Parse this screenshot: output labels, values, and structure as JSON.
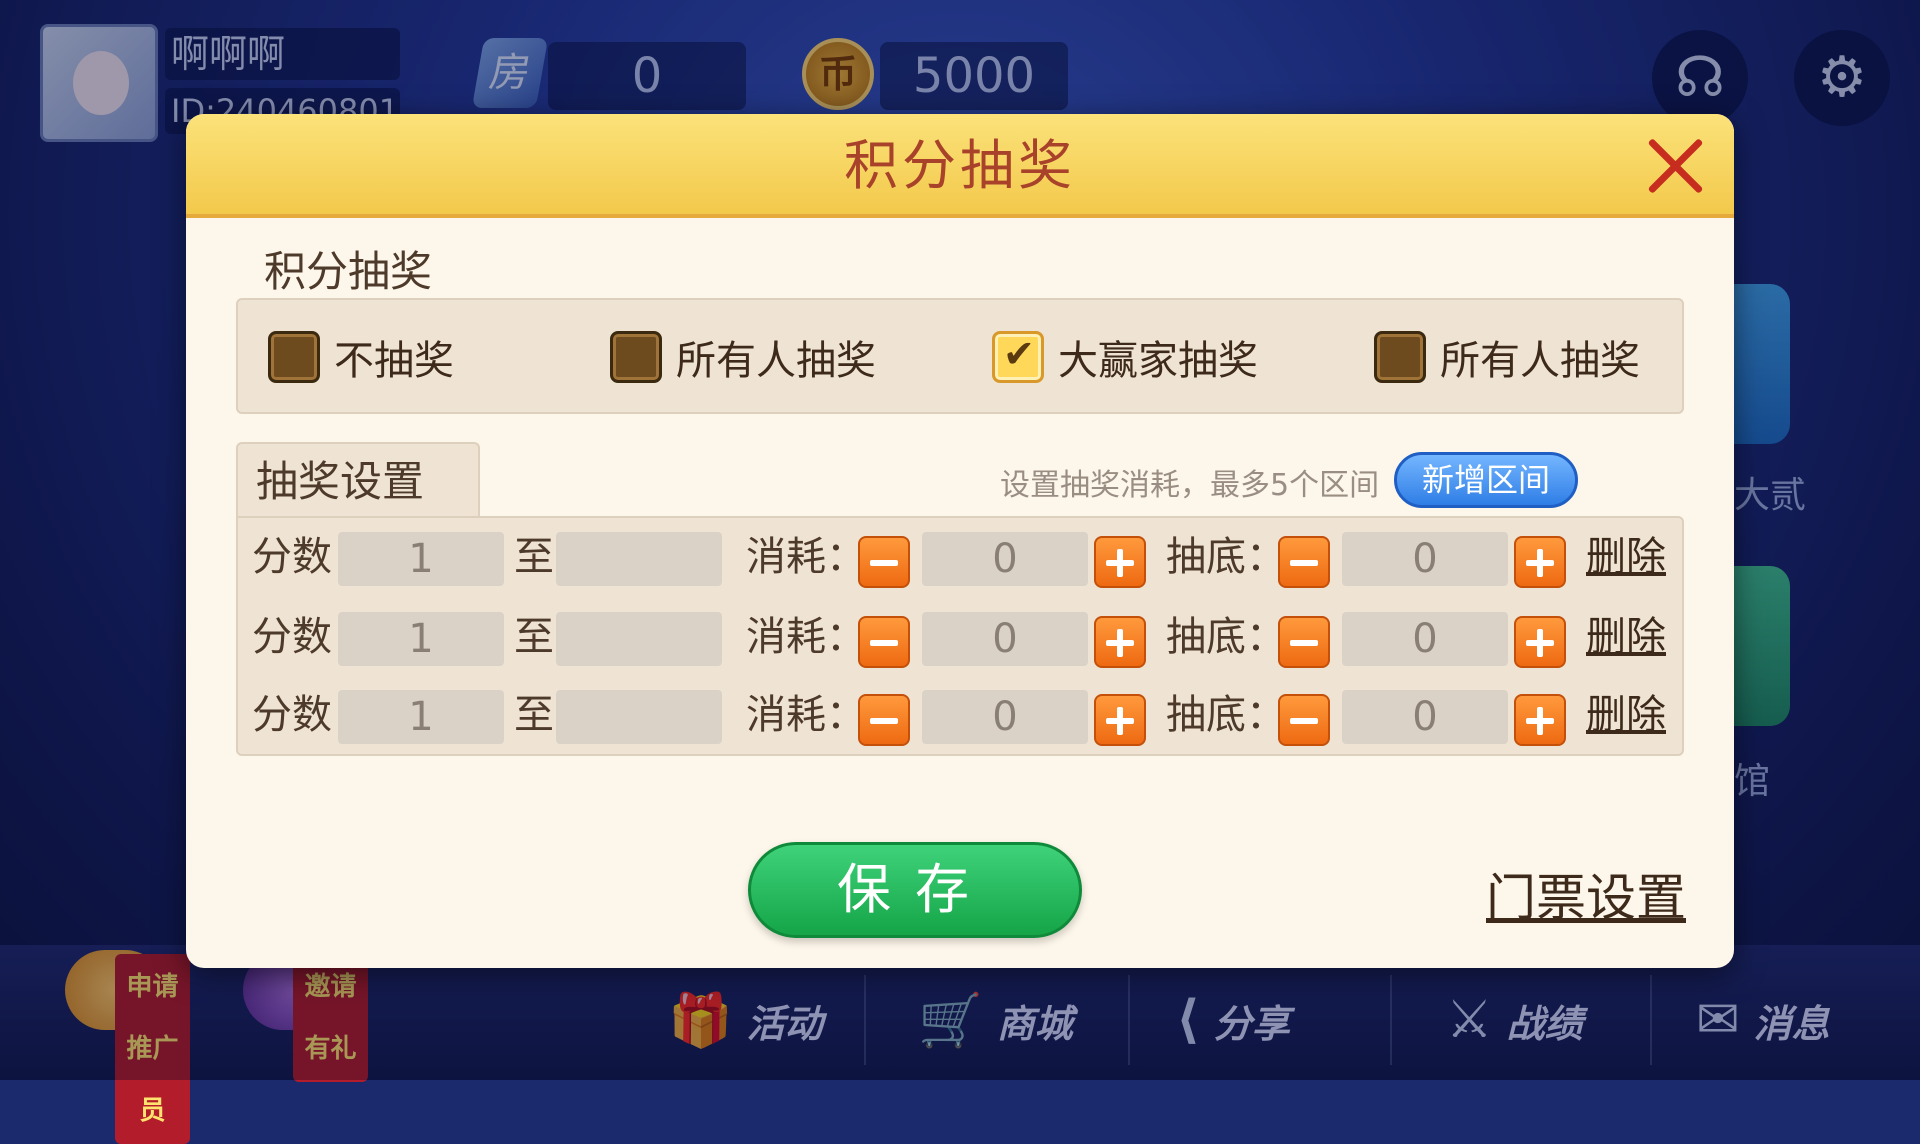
{
  "player": {
    "name": "啊啊啊",
    "id_text": "ID:240460801"
  },
  "room": {
    "icon_char": "房",
    "value": "0"
  },
  "coins": {
    "icon_char": "币",
    "value": "5000"
  },
  "top_icons": {
    "support": "headset-icon",
    "settings": "gear-icon"
  },
  "side_labels": {
    "label1": "大贰",
    "label2": "馆"
  },
  "bottom_nav": {
    "promoter": "申请推广员",
    "invite": "邀请有礼",
    "items": [
      {
        "icon": "gift-icon",
        "label": "活动"
      },
      {
        "icon": "cart-icon",
        "label": "商城"
      },
      {
        "icon": "share-icon",
        "label": "分享"
      },
      {
        "icon": "swords-icon",
        "label": "战绩"
      },
      {
        "icon": "mail-icon",
        "label": "消息"
      }
    ]
  },
  "dialog": {
    "title": "积分抽奖",
    "section_label": "积分抽奖",
    "options": [
      {
        "label": "不抽奖",
        "checked": false
      },
      {
        "label": "所有人抽奖",
        "checked": false
      },
      {
        "label": "大赢家抽奖",
        "checked": true
      },
      {
        "label": "所有人抽奖",
        "checked": false
      }
    ],
    "tab_label": "抽奖设置",
    "hint": "设置抽奖消耗，最多5个区间",
    "add_button": "新增区间",
    "row_labels": {
      "score": "分数",
      "to": "至",
      "cost": "消耗：",
      "floor": "抽底：",
      "delete": "删除"
    },
    "rows": [
      {
        "from": "1",
        "to": "",
        "cost": "0",
        "floor": "0"
      },
      {
        "from": "1",
        "to": "",
        "cost": "0",
        "floor": "0"
      },
      {
        "from": "1",
        "to": "",
        "cost": "0",
        "floor": "0"
      }
    ],
    "save_button": "保存",
    "ticket_link": "门票设置"
  }
}
